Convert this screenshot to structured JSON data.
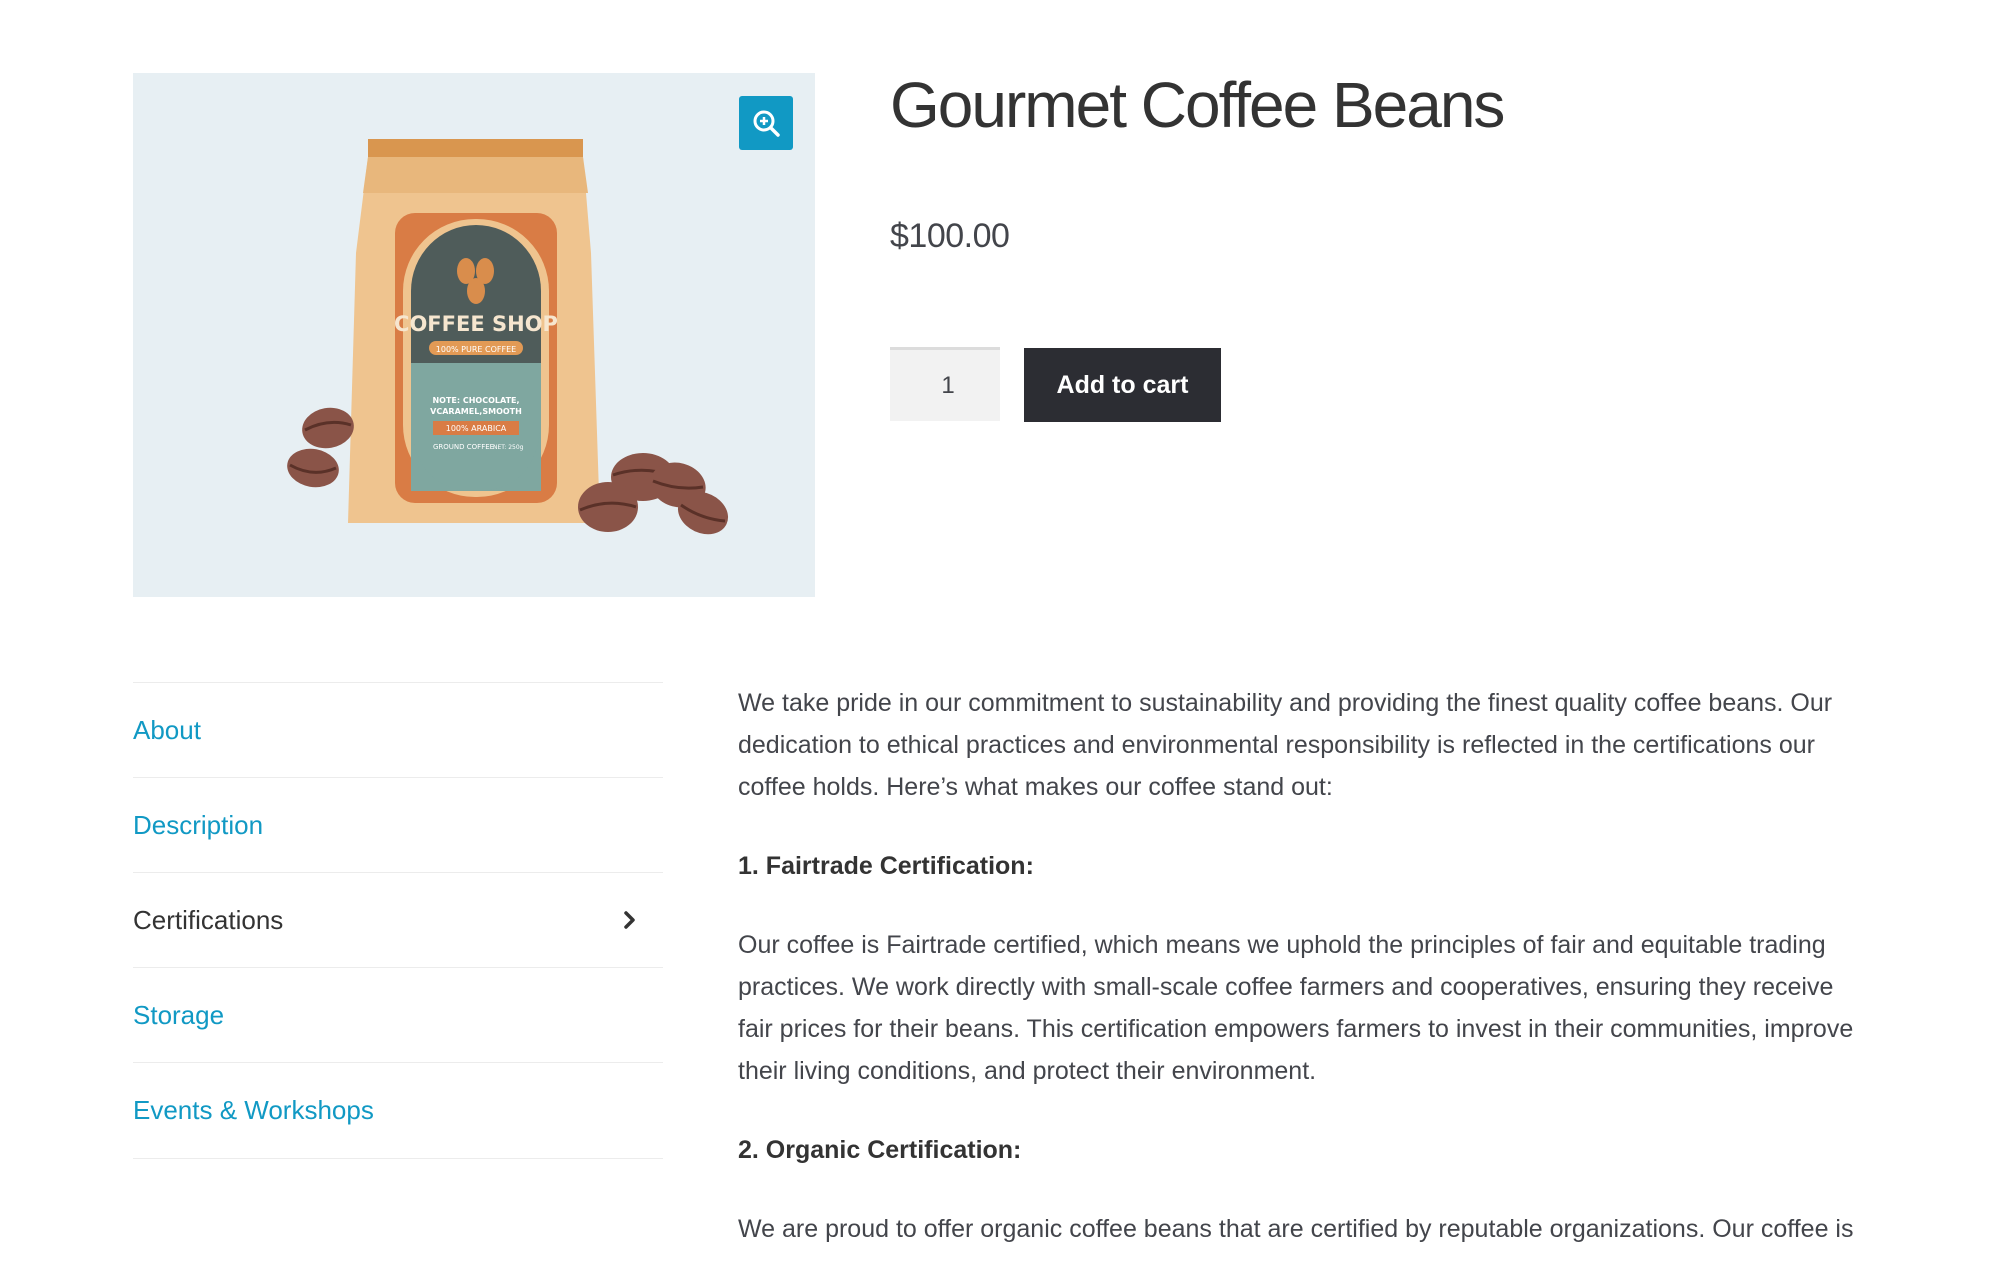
{
  "product": {
    "title": "Gourmet Coffee Beans",
    "price": "$100.00",
    "quantity": "1",
    "add_to_cart_label": "Add to cart"
  },
  "image": {
    "bag_brand": "COFFEE SHOP",
    "bag_tagline": "100% PURE COFFEE",
    "bag_note_line1": "NOTE: CHOCOLATE,",
    "bag_note_line2": "VCARAMEL,SMOOTH",
    "bag_badge": "100% ARABICA",
    "bag_ground": "GROUND COFFEE",
    "bag_weight": "NET: 250g"
  },
  "tabs": [
    {
      "label": "About",
      "active": false
    },
    {
      "label": "Description",
      "active": false
    },
    {
      "label": "Certifications",
      "active": true
    },
    {
      "label": "Storage",
      "active": false
    },
    {
      "label": "Events & Workshops",
      "active": false
    }
  ],
  "content": {
    "intro": "We take pride in our commitment to sustainability and providing the finest quality coffee beans. Our dedication to ethical practices and environmental responsibility is reflected in the certifications our coffee holds. Here’s what makes our coffee stand out:",
    "heading1": "1. Fairtrade Certification:",
    "para1": "Our coffee is Fairtrade certified, which means we uphold the principles of fair and equitable trading practices. We work directly with small-scale coffee farmers and cooperatives, ensuring they receive fair prices for their beans. This certification empowers farmers to invest in their communities, improve their living conditions, and protect their environment.",
    "heading2": "2. Organic Certification:",
    "para2": "We are proud to offer organic coffee beans that are certified by reputable organizations. Our coffee is"
  },
  "icons": {
    "zoom": "zoom-in-icon",
    "chevron": "chevron-right-icon"
  },
  "colors": {
    "link": "#1199c4",
    "button_dark": "#2c2d33",
    "zoom_button": "#1199c4",
    "gallery_bg": "#e7eff3"
  }
}
